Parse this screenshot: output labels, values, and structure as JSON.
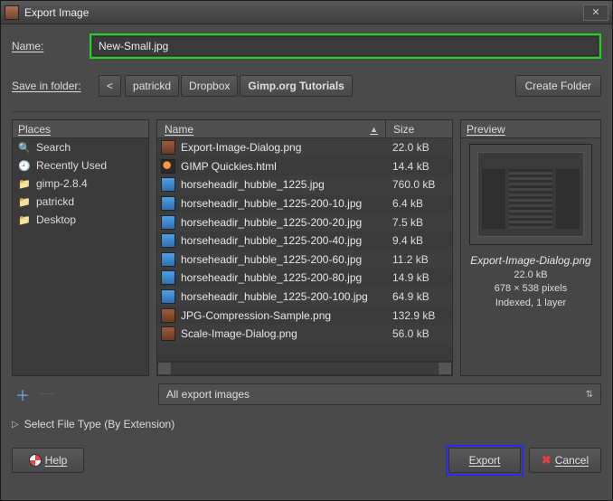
{
  "window": {
    "title": "Export Image"
  },
  "name": {
    "label": "Name:",
    "value": "New-Small.jpg"
  },
  "folder": {
    "label": "Save in folder:",
    "back": "<",
    "crumbs": [
      "patrickd",
      "Dropbox",
      "Gimp.org Tutorials"
    ],
    "active_index": 2,
    "create": "Create Folder"
  },
  "places": {
    "header": "Places",
    "items": [
      {
        "icon": "search",
        "label": "Search"
      },
      {
        "icon": "recent",
        "label": "Recently Used"
      },
      {
        "icon": "folder",
        "label": "gimp-2.8.4"
      },
      {
        "icon": "folder",
        "label": "patrickd"
      },
      {
        "icon": "folder",
        "label": "Desktop"
      }
    ]
  },
  "files": {
    "header_name": "Name",
    "header_size": "Size",
    "rows": [
      {
        "icon": "png",
        "name": "Export-Image-Dialog.png",
        "size": "22.0 kB"
      },
      {
        "icon": "html",
        "name": "GIMP Quickies.html",
        "size": "14.4 kB"
      },
      {
        "icon": "jpg",
        "name": "horseheadir_hubble_1225.jpg",
        "size": "760.0 kB"
      },
      {
        "icon": "jpg",
        "name": "horseheadir_hubble_1225-200-10.jpg",
        "size": "6.4 kB"
      },
      {
        "icon": "jpg",
        "name": "horseheadir_hubble_1225-200-20.jpg",
        "size": "7.5 kB"
      },
      {
        "icon": "jpg",
        "name": "horseheadir_hubble_1225-200-40.jpg",
        "size": "9.4 kB"
      },
      {
        "icon": "jpg",
        "name": "horseheadir_hubble_1225-200-60.jpg",
        "size": "11.2 kB"
      },
      {
        "icon": "jpg",
        "name": "horseheadir_hubble_1225-200-80.jpg",
        "size": "14.9 kB"
      },
      {
        "icon": "jpg",
        "name": "horseheadir_hubble_1225-200-100.jpg",
        "size": "64.9 kB"
      },
      {
        "icon": "png",
        "name": "JPG-Compression-Sample.png",
        "size": "132.9 kB"
      },
      {
        "icon": "png",
        "name": "Scale-Image-Dialog.png",
        "size": "56.0 kB"
      }
    ]
  },
  "preview": {
    "header": "Preview",
    "filename": "Export-Image-Dialog.png",
    "filesize": "22.0 kB",
    "dimensions": "678 × 538 pixels",
    "mode": "Indexed, 1 layer"
  },
  "filter": {
    "label": "All export images"
  },
  "filetype": {
    "label": "Select File Type (By Extension)"
  },
  "buttons": {
    "help": "Help",
    "export": "Export",
    "cancel": "Cancel"
  }
}
